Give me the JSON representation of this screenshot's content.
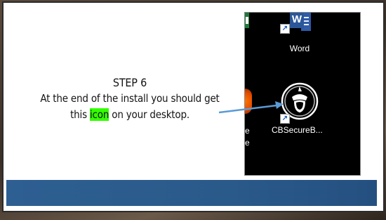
{
  "slide": {
    "step": "STEP 6",
    "line1": "At the end of the install you should get",
    "line2_pre": "this ",
    "line2_highlight": "icon",
    "line2_post": " on your desktop."
  },
  "desktop": {
    "word_label": "Word",
    "word_letter": "W",
    "cb_label": "CBSecureB...",
    "left_label_1": "e",
    "left_label_2": "e",
    "icons": [
      "word-icon",
      "cbsecure-browser-icon",
      "shortcut-arrow-icon"
    ]
  },
  "colors": {
    "highlight": "#33ff00",
    "bar": "#2e5f92",
    "arrow": "#5a9bd5"
  }
}
